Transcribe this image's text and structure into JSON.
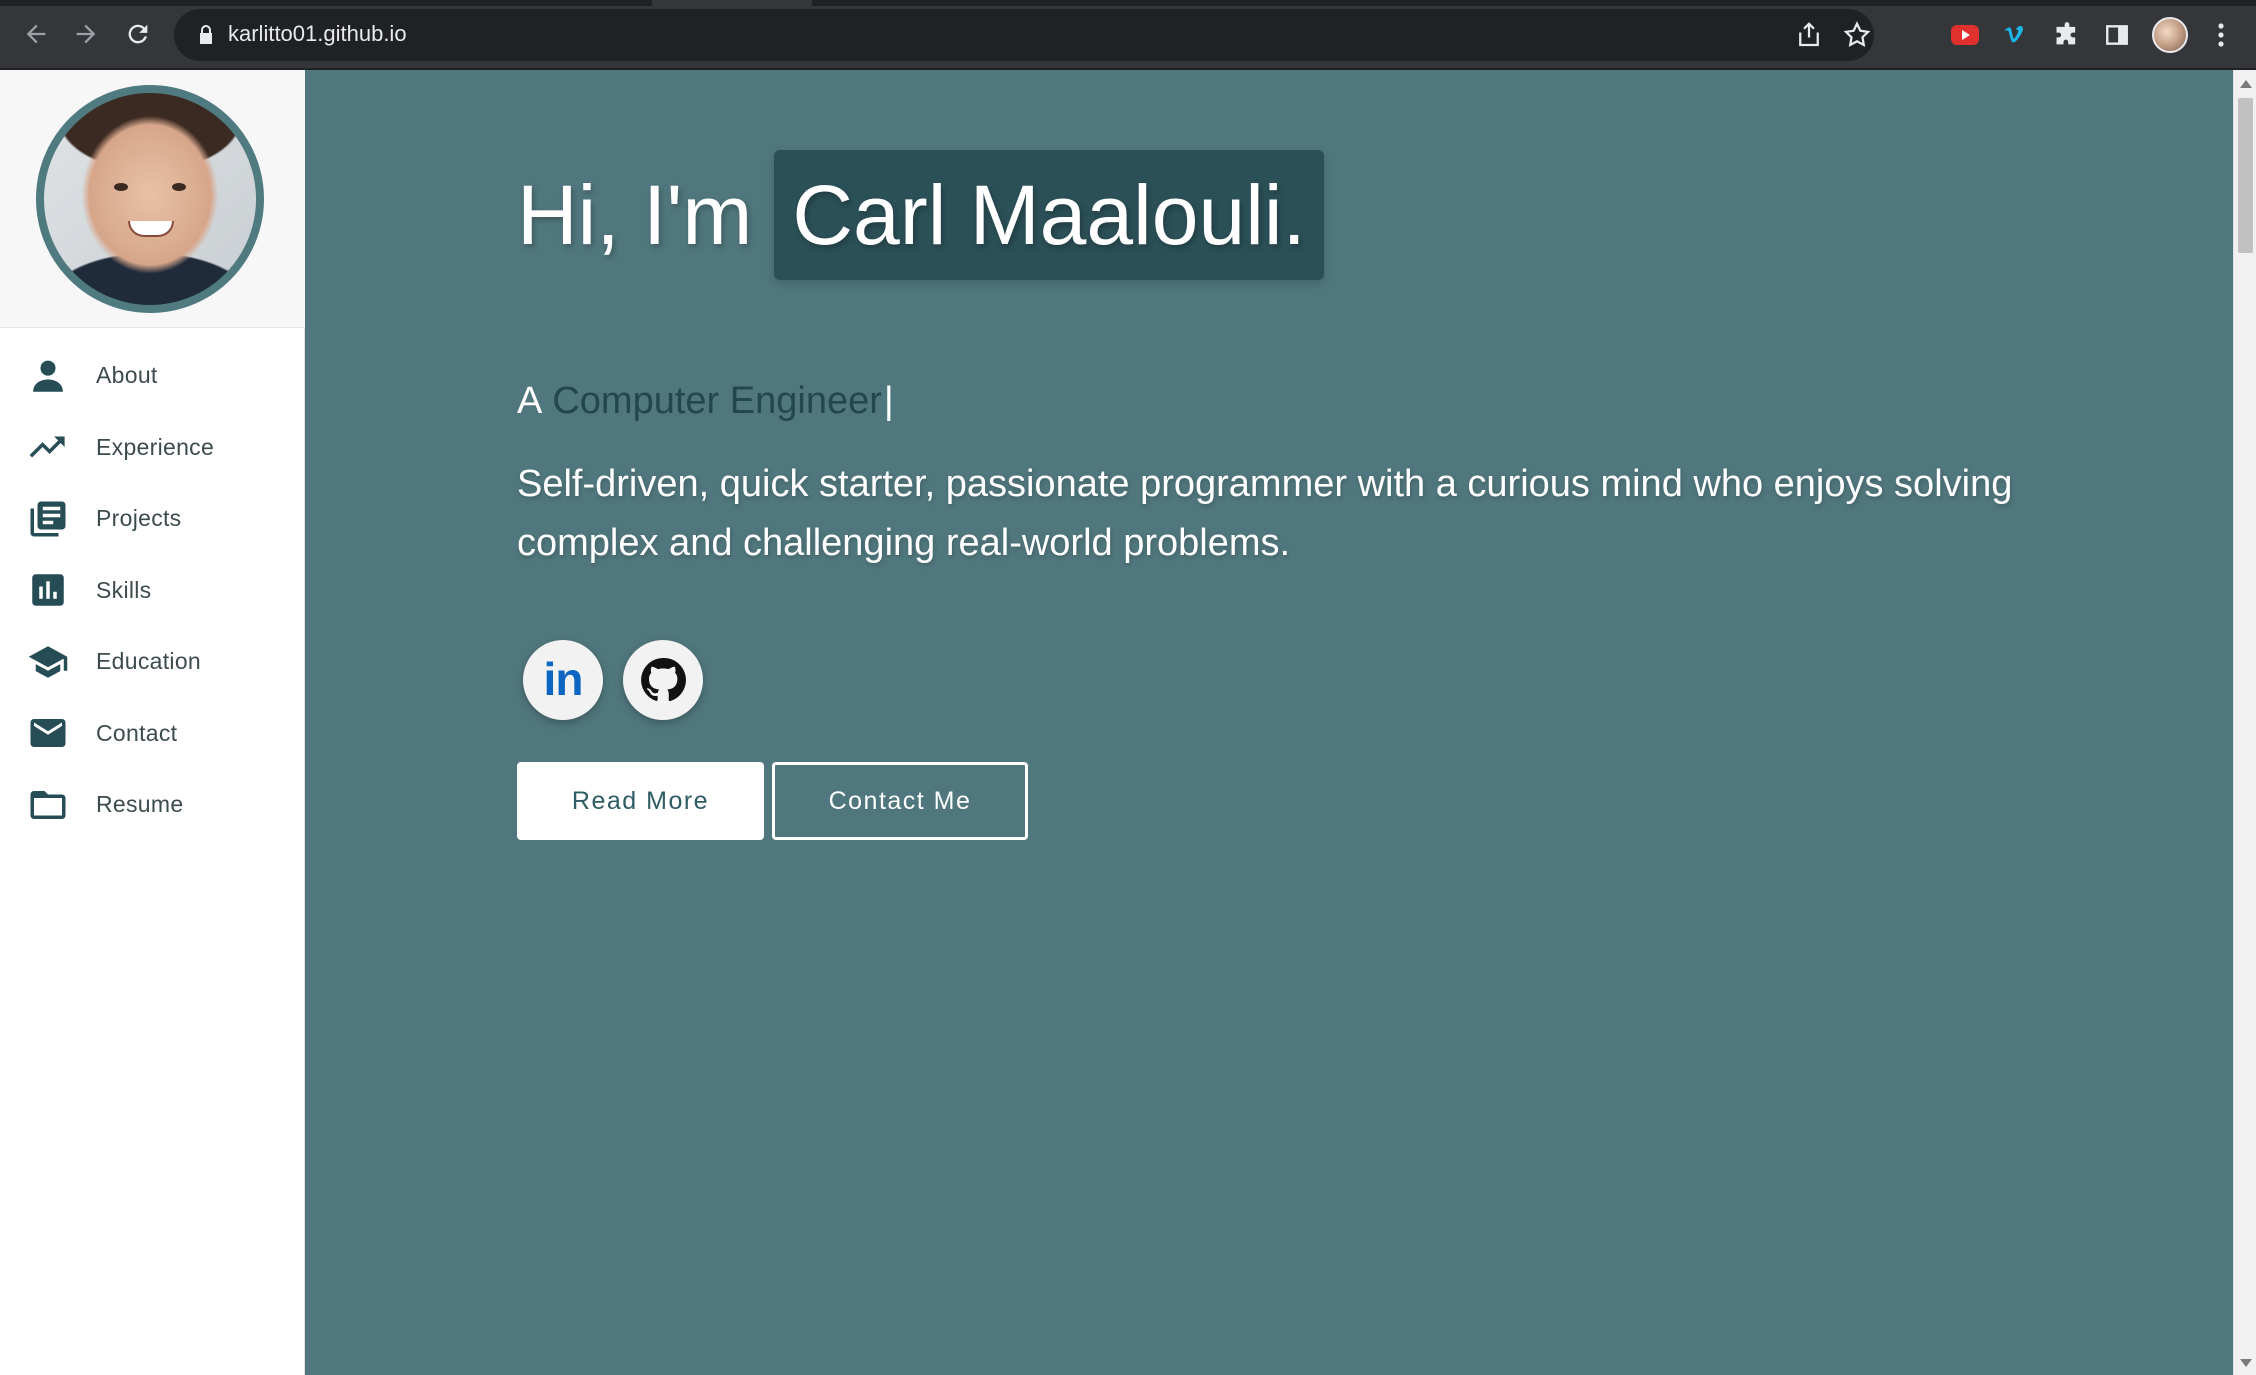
{
  "browser": {
    "url": "karlitto01.github.io",
    "icons": {
      "back": "back-arrow-icon",
      "forward": "forward-arrow-icon",
      "reload": "reload-icon",
      "lock": "lock-icon",
      "share": "share-icon",
      "bookmark": "star-icon",
      "ext1": "youtube-ext-icon",
      "ext2": "vimeo-ext-icon",
      "extensions": "puzzle-icon",
      "sidepanel": "side-panel-icon",
      "menu": "kebab-menu-icon"
    }
  },
  "sidebar": {
    "items": [
      {
        "label": "About",
        "icon": "person-icon"
      },
      {
        "label": "Experience",
        "icon": "trending-up-icon"
      },
      {
        "label": "Projects",
        "icon": "library-books-icon"
      },
      {
        "label": "Skills",
        "icon": "bar-chart-icon"
      },
      {
        "label": "Education",
        "icon": "graduation-cap-icon"
      },
      {
        "label": "Contact",
        "icon": "mail-icon"
      },
      {
        "label": "Resume",
        "icon": "folder-icon"
      }
    ]
  },
  "hero": {
    "greeting": "Hi, I'm",
    "name": "Carl Maalouli.",
    "role_prefix": "A",
    "role": "Computer Engineer",
    "caret": "|",
    "summary": "Self-driven, quick starter, passionate programmer with a curious mind who enjoys solving complex and challenging real-world problems.",
    "social": [
      {
        "icon": "linkedin-icon",
        "glyph": "in"
      },
      {
        "icon": "github-icon"
      }
    ],
    "buttons": {
      "read_more": "Read More",
      "contact_me": "Contact Me"
    }
  },
  "colors": {
    "main_bg": "#50777d",
    "name_bg": "#2b5057",
    "accent_text": "#23474d",
    "icon": "#264d55",
    "avatar_ring": "#4f7a80"
  }
}
